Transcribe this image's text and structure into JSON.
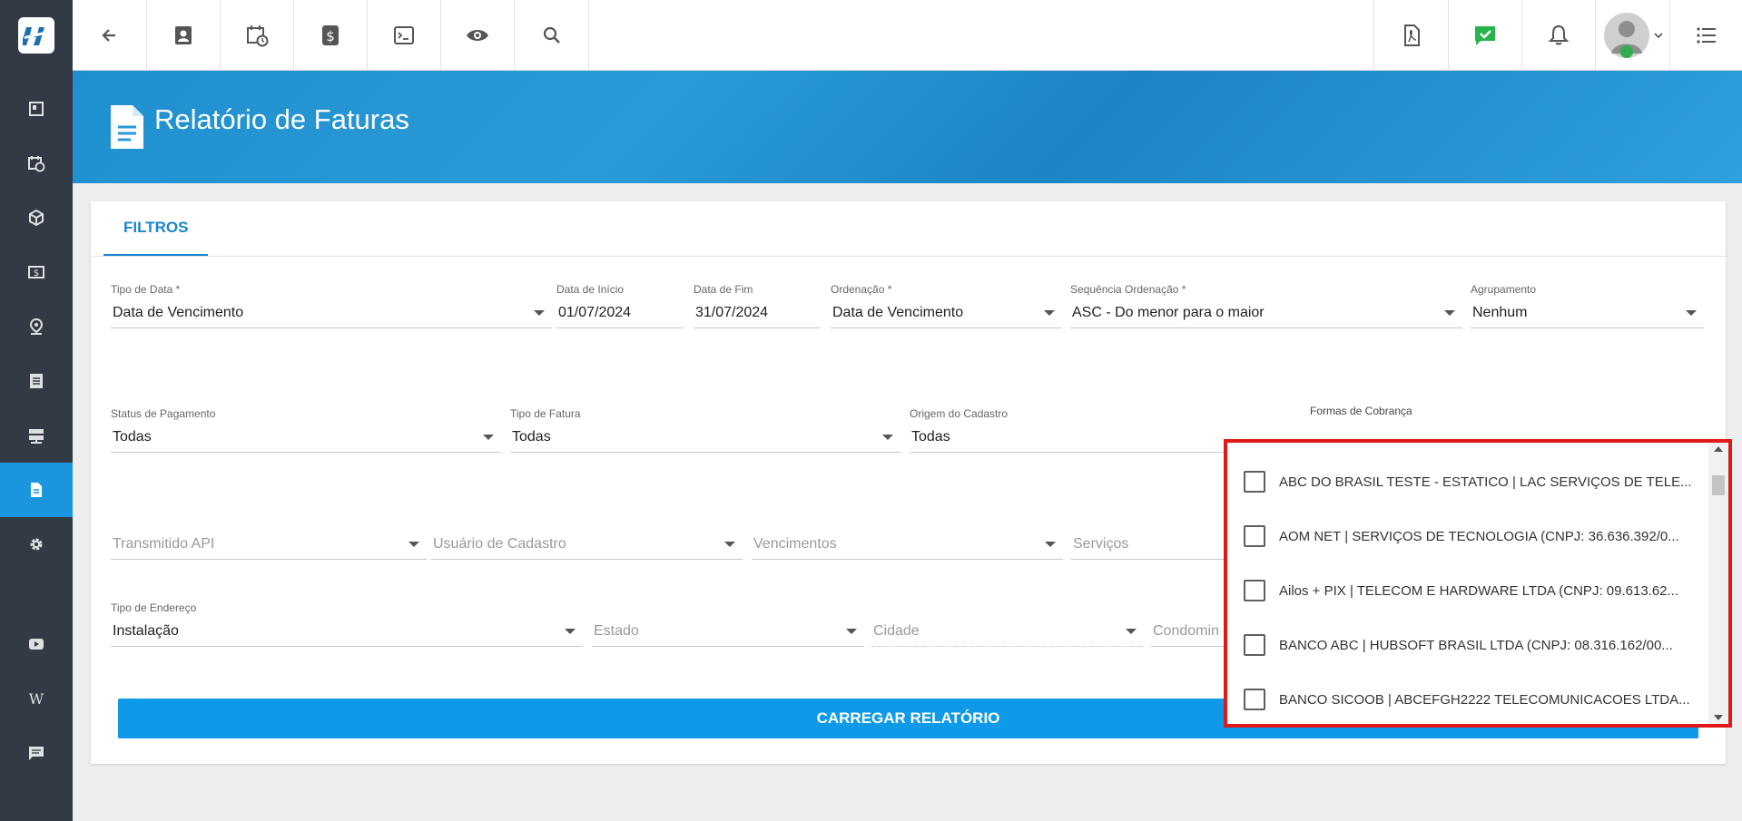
{
  "header": {
    "title": "Relatório de Faturas"
  },
  "tabs": [
    {
      "label": "FILTROS"
    }
  ],
  "filters": {
    "tipo_data": {
      "label": "Tipo de Data *",
      "value": "Data de Vencimento"
    },
    "data_inicio": {
      "label": "Data de Início",
      "value": "01/07/2024"
    },
    "data_fim": {
      "label": "Data de Fim",
      "value": "31/07/2024"
    },
    "ordenacao": {
      "label": "Ordenação *",
      "value": "Data de Vencimento"
    },
    "sequencia": {
      "label": "Sequência Ordenação *",
      "value": "ASC - Do menor para o maior"
    },
    "agrupamento": {
      "label": "Agrupamento",
      "value": "Nenhum"
    },
    "status_pagamento": {
      "label": "Status de Pagamento",
      "value": "Todas"
    },
    "tipo_fatura": {
      "label": "Tipo de Fatura",
      "value": "Todas"
    },
    "origem_cadastro": {
      "label": "Origem do Cadastro",
      "value": "Todas"
    },
    "formas_cobranca": {
      "label": "Formas de Cobrança"
    },
    "transmitido_api": {
      "placeholder": "Transmitido API"
    },
    "usuario_cadastro": {
      "placeholder": "Usuário de Cadastro"
    },
    "vencimentos": {
      "placeholder": "Vencimentos"
    },
    "servicos": {
      "placeholder": "Serviços"
    },
    "tipo_endereco": {
      "label": "Tipo de Endereço",
      "value": "Instalação"
    },
    "estado": {
      "placeholder": "Estado"
    },
    "cidade": {
      "placeholder": "Cidade"
    },
    "condominio": {
      "placeholder": "Condomin"
    }
  },
  "load_button": "CARREGAR RELATÓRIO",
  "dropdown_options": [
    "ABC DO BRASIL TESTE - ESTATICO | LAC SERVIÇOS DE TELE...",
    "AOM NET | SERVIÇOS DE TECNOLOGIA (CNPJ: 36.636.392/0...",
    "Ailos + PIX | TELECOM E HARDWARE LTDA (CNPJ: 09.613.62...",
    "BANCO ABC | HUBSOFT BRASIL LTDA (CNPJ: 08.316.162/00...",
    "BANCO SICOOB | ABCEFGH2222 TELECOMUNICACOES LTDA..."
  ],
  "icons": {
    "sidebar": [
      "dashboard-icon",
      "calendar-clock-icon",
      "box-icon",
      "money-icon",
      "map-pin-icon",
      "list-icon",
      "server-icon",
      "report-icon",
      "gear-icon",
      "video-icon",
      "wiki-icon",
      "chat-icon"
    ],
    "wiki_glyph": "W"
  },
  "colors": {
    "accent": "#1a96df",
    "sidebar": "#323a45",
    "highlight": "#e01919",
    "button": "#0e9ae8"
  }
}
